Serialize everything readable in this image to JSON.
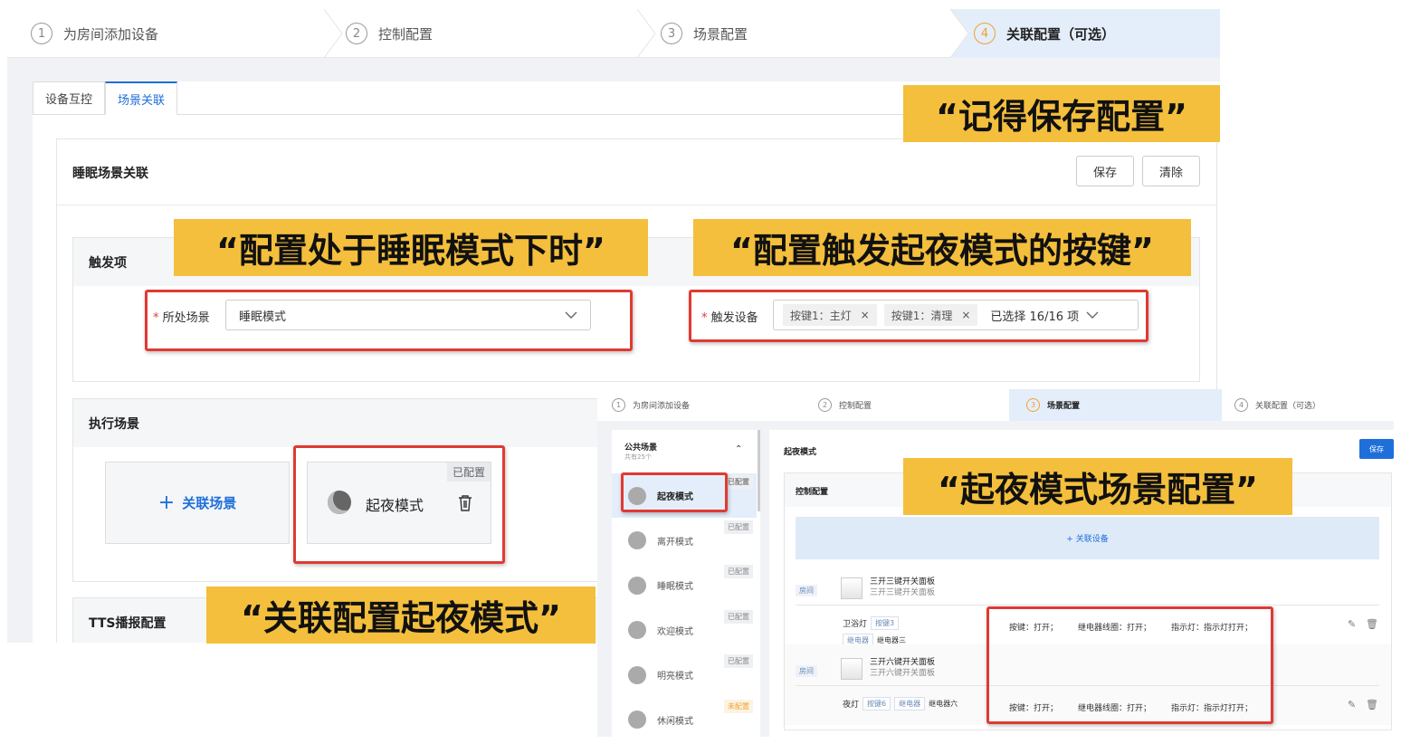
{
  "main": {
    "steps": [
      {
        "num": "1",
        "label": "为房间添加设备"
      },
      {
        "num": "2",
        "label": "控制配置"
      },
      {
        "num": "3",
        "label": "场景配置"
      },
      {
        "num": "4",
        "label": "关联配置（可选）"
      }
    ],
    "tabs": [
      "设备互控",
      "场景关联"
    ],
    "card_title": "睡眠场景关联",
    "save": "保存",
    "clear": "清除",
    "trigger": {
      "title": "触发项",
      "scene_label": "所处场景",
      "scene_value": "睡眠模式",
      "device_label": "触发设备",
      "device_tags": [
        "按键1：主灯",
        "按键1：清理"
      ],
      "selected": "已选择 16/16 项",
      "required": "*"
    },
    "exec": {
      "title": "执行场景",
      "add": "关联场景",
      "scene_name": "起夜模式",
      "scene_tag": "已配置"
    },
    "tts_title": "TTS播报配置"
  },
  "inset": {
    "steps": [
      {
        "num": "1",
        "label": "为房间添加设备"
      },
      {
        "num": "2",
        "label": "控制配置"
      },
      {
        "num": "3",
        "label": "场景配置"
      },
      {
        "num": "4",
        "label": "关联配置（可选）"
      }
    ],
    "group_title": "公共场景",
    "group_count": "共有25个",
    "scenes": [
      {
        "name": "起夜模式",
        "tag": "已配置"
      },
      {
        "name": "离开模式",
        "tag": "已配置"
      },
      {
        "name": "睡眠模式",
        "tag": "已配置"
      },
      {
        "name": "欢迎模式",
        "tag": "已配置"
      },
      {
        "name": "明亮模式",
        "tag": "已配置"
      },
      {
        "name": "休闲模式",
        "tag": "未配置"
      }
    ],
    "title": "起夜模式",
    "save": "保存",
    "control_title": "控制配置",
    "add_device": "+ 关联设备",
    "devices": [
      {
        "room": "房间",
        "name": "三开三键开关面板",
        "sub": "三开三键开关面板",
        "light": "卫浴灯",
        "key": "按键3",
        "relay_tag": "继电器",
        "relay": "继电器三",
        "key_action": "按键：打开；",
        "relay_action": "继电器线圈：打开；",
        "indicator": "指示灯：指示灯打开；"
      },
      {
        "room": "房间",
        "name": "三开六键开关面板",
        "sub": "三开六键开关面板",
        "light": "夜灯",
        "key": "按键6",
        "relay_tag": "继电器",
        "relay": "继电器六",
        "key_action": "按键：打开；",
        "relay_action": "继电器线圈：打开；",
        "indicator": "指示灯：指示灯打开；"
      }
    ]
  },
  "callouts": {
    "save": "“记得保存配置”",
    "sleep": "“配置处于睡眠模式下时”",
    "key": "“配置触发起夜模式的按键”",
    "link": "“关联配置起夜模式”",
    "scene": "“起夜模式场景配置”"
  },
  "colors": {
    "accent": "#1e6fd9",
    "callout": "#f4bf3c",
    "highlight": "#e03a32"
  }
}
